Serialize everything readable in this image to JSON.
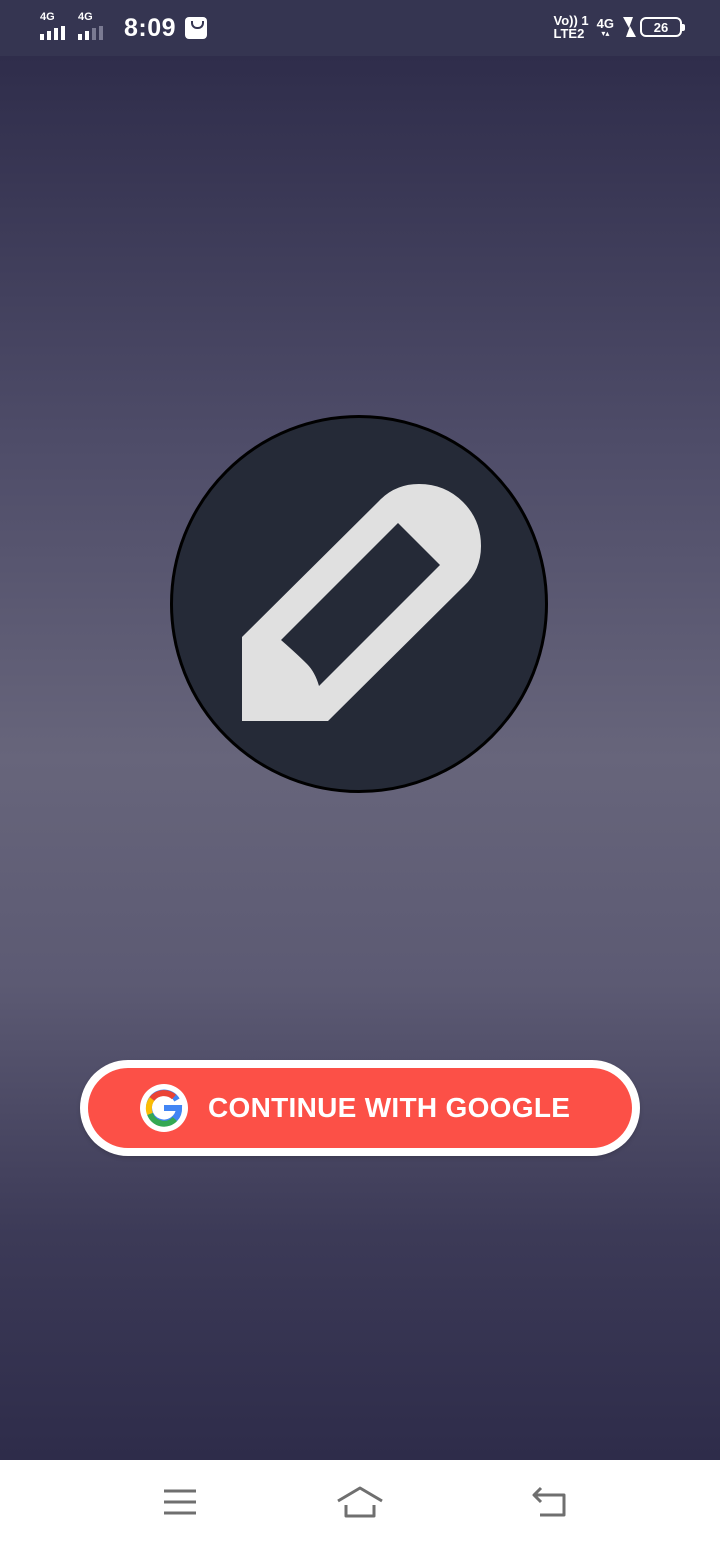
{
  "status_bar": {
    "sim1_network": "4G",
    "sim2_network": "4G",
    "time": "8:09",
    "volte_line1": "Vo)) 1",
    "volte_line2": "LTE2",
    "data_network": "4G",
    "battery_level": "26"
  },
  "app": {
    "logo_icon": "pencil-icon",
    "google_button": {
      "label": "CONTINUE WITH GOOGLE",
      "icon": "google-icon",
      "color": "#fc5047"
    }
  },
  "nav_bar": {
    "menu_icon": "menu-icon",
    "home_icon": "home-icon",
    "back_icon": "back-icon"
  },
  "colors": {
    "status_bar_bg": "#353551",
    "logo_bg": "#252a37",
    "pencil_color": "#e0e0e0",
    "accent": "#fc5047"
  }
}
